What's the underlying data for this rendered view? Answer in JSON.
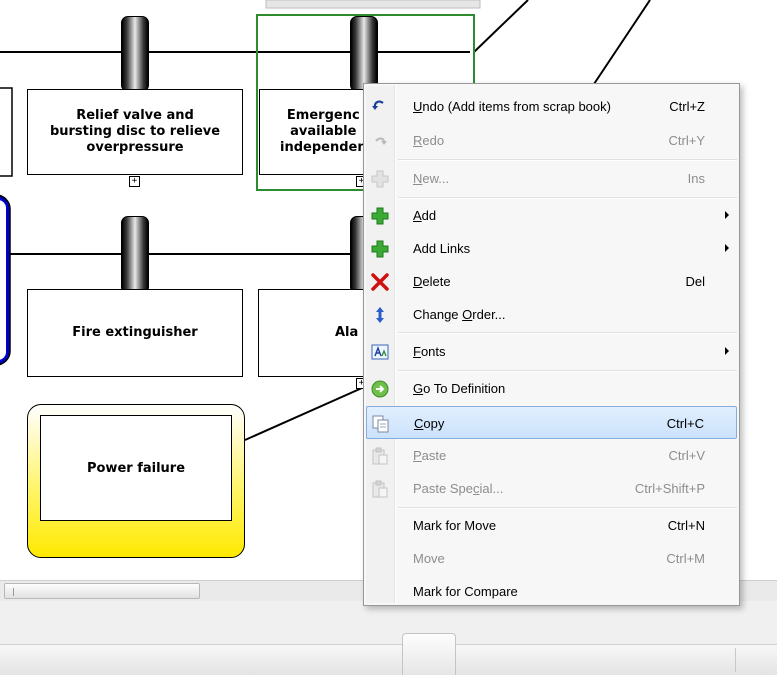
{
  "diagram": {
    "barriers": [
      {
        "id": "relief",
        "label": "Relief valve and\nbursting disc to relieve\noverpressure"
      },
      {
        "id": "emergency",
        "label": "Emergenc\navailable\nindependen"
      },
      {
        "id": "fire",
        "label": "Fire extinguisher"
      },
      {
        "id": "alarm",
        "label": "Ala"
      }
    ],
    "expander_symbol": "+",
    "event": {
      "label": "Power failure"
    }
  },
  "context_menu": {
    "items": [
      {
        "pre": "",
        "key": "U",
        "post": "ndo (Add items from scrap book)",
        "shortcut": "Ctrl+Z",
        "icon": "undo-icon",
        "disabled": false,
        "submenu": false
      },
      {
        "pre": "",
        "key": "R",
        "post": "edo",
        "shortcut": "Ctrl+Y",
        "icon": "redo-icon",
        "disabled": true,
        "submenu": false
      },
      {
        "pre": "",
        "key": "N",
        "post": "ew...",
        "shortcut": "Ins",
        "icon": "new-icon",
        "disabled": true,
        "submenu": false
      },
      {
        "pre": "",
        "key": "A",
        "post": "dd",
        "shortcut": "",
        "icon": "add-icon",
        "disabled": false,
        "submenu": true
      },
      {
        "pre": "Add Links",
        "key": "",
        "post": "",
        "shortcut": "",
        "icon": "add-links-icon",
        "disabled": false,
        "submenu": true
      },
      {
        "pre": "",
        "key": "D",
        "post": "elete",
        "shortcut": "Del",
        "icon": "delete-icon",
        "disabled": false,
        "submenu": false
      },
      {
        "pre": "Change ",
        "key": "O",
        "post": "rder...",
        "shortcut": "",
        "icon": "change-order-icon",
        "disabled": false,
        "submenu": false
      },
      {
        "pre": "",
        "key": "F",
        "post": "onts",
        "shortcut": "",
        "icon": "fonts-icon",
        "disabled": false,
        "submenu": true
      },
      {
        "pre": "",
        "key": "G",
        "post": "o To Definition",
        "shortcut": "",
        "icon": "go-to-definition-icon",
        "disabled": false,
        "submenu": false
      },
      {
        "pre": "",
        "key": "C",
        "post": "opy",
        "shortcut": "Ctrl+C",
        "icon": "copy-icon",
        "disabled": false,
        "submenu": false,
        "highlight": true
      },
      {
        "pre": "",
        "key": "P",
        "post": "aste",
        "shortcut": "Ctrl+V",
        "icon": "paste-icon",
        "disabled": true,
        "submenu": false
      },
      {
        "pre": "Paste Spe",
        "key": "c",
        "post": "ial...",
        "shortcut": "Ctrl+Shift+P",
        "icon": "paste-special-icon",
        "disabled": true,
        "submenu": false
      },
      {
        "pre": "Mark for Move",
        "key": "",
        "post": "",
        "shortcut": "Ctrl+N",
        "icon": "",
        "disabled": false,
        "submenu": false
      },
      {
        "pre": "Move",
        "key": "",
        "post": "",
        "shortcut": "Ctrl+M",
        "icon": "",
        "disabled": true,
        "submenu": false
      },
      {
        "pre": "Mark for Compare",
        "key": "",
        "post": "",
        "shortcut": "",
        "icon": "",
        "disabled": false,
        "submenu": false
      }
    ]
  },
  "colors": {
    "selection_border": "#2e8b2e",
    "event_yellow": "#ffe900",
    "menu_highlight": "#cbe2fb",
    "delete_red": "#d01010",
    "add_green": "#3aaa35",
    "threat_blue": "#0000c8"
  }
}
